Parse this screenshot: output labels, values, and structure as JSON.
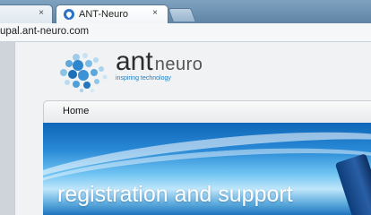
{
  "browser": {
    "tabs": [
      {
        "title": "",
        "has_close": true
      },
      {
        "title": "ANT-Neuro",
        "has_close": true,
        "active": true
      }
    ],
    "close_glyph": "×",
    "url": "upal.ant-neuro.com"
  },
  "site": {
    "logo": {
      "brand": "ant",
      "brand_sub": "neuro",
      "tagline": "inspiring technology"
    },
    "nav": {
      "items": [
        "Home"
      ]
    },
    "banner": {
      "title": "registration and support"
    }
  },
  "colors": {
    "brand_blue": "#1b7ec2",
    "chrome_frame": "#6f91ad"
  }
}
